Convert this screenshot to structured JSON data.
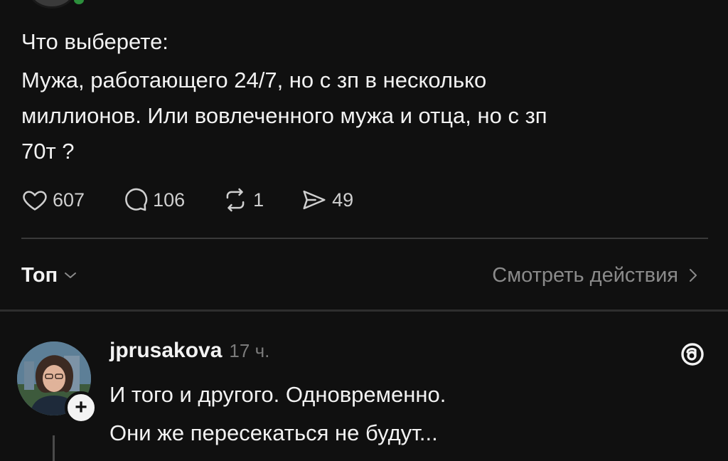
{
  "post": {
    "question": "Что выберете:",
    "body_lines": [
      "Мужа, работающего 24/7, но с зп в несколько",
      "миллионов. Или вовлеченного мужа и отца, но с зп",
      "70т ?"
    ],
    "actions": {
      "likes": "607",
      "comments": "106",
      "reposts": "1",
      "shares": "49"
    }
  },
  "sort_bar": {
    "sort_label": "Топ",
    "view_activity_label": "Смотреть действия"
  },
  "reply": {
    "username": "jprusakova",
    "time": "17 ч.",
    "lines": [
      "И того и другого. Одновременно.",
      "Они же пересекаться не будут..."
    ],
    "follow_symbol": "+"
  },
  "icons": {
    "like": "heart-icon",
    "comment": "speech-bubble-icon",
    "repost": "repost-icon",
    "share": "send-icon",
    "sort_dropdown": "chevron-down-icon",
    "view_more": "chevron-right-icon",
    "threads": "threads-logo-icon"
  },
  "colors": {
    "background": "#101010",
    "text": "#f2f2f2",
    "muted": "#8a8a8a",
    "divider": "#3a3a3a"
  }
}
